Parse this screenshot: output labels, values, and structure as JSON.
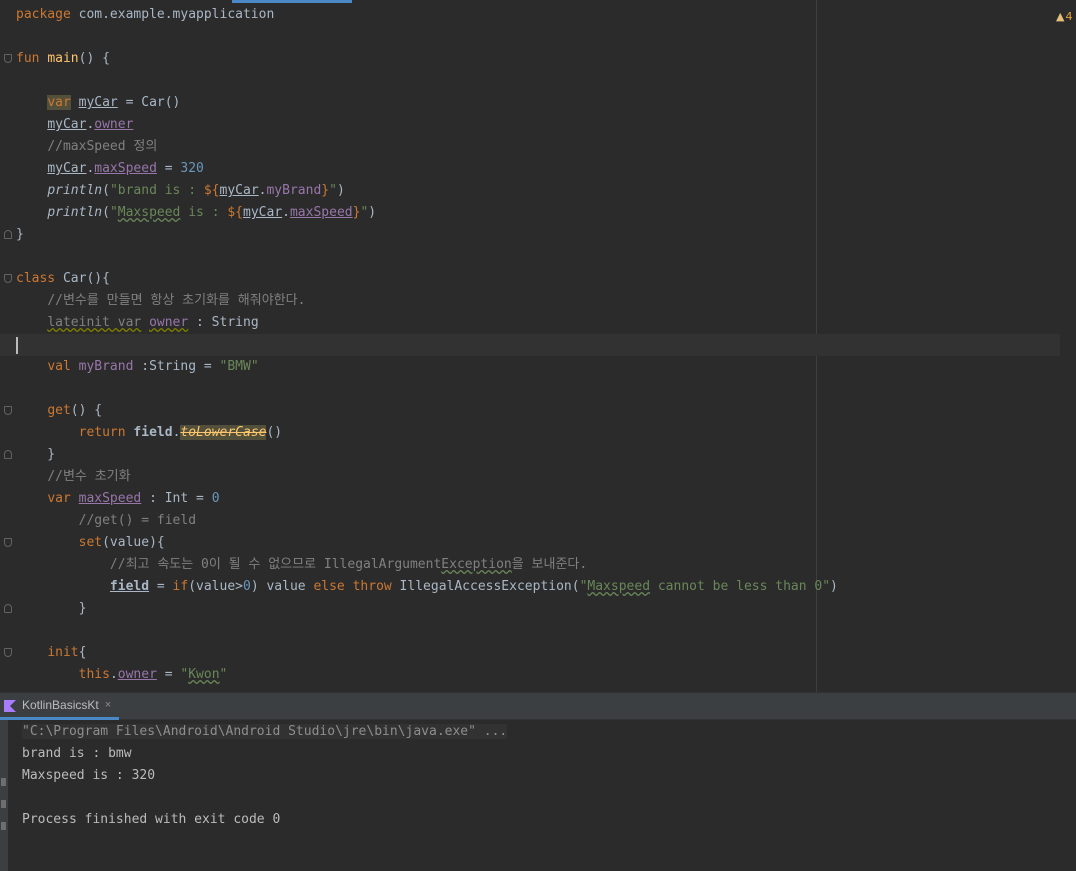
{
  "editor": {
    "warning_count": "4",
    "lines": [
      [
        "package com.example.myapplication"
      ],
      [
        ""
      ],
      [
        "fun main() {"
      ],
      [
        ""
      ],
      [
        "    var myCar = Car()"
      ],
      [
        "    myCar.owner"
      ],
      [
        "    //maxSpeed 정의"
      ],
      [
        "    myCar.maxSpeed = 320"
      ],
      [
        "    println(\"brand is : ${myCar.myBrand}\")"
      ],
      [
        "    println(\"Maxspeed is : ${myCar.maxSpeed}\")"
      ],
      [
        "}"
      ],
      [
        ""
      ],
      [
        "class Car(){"
      ],
      [
        "    //변수를 만들면 항상 초기화를 해줘야한다."
      ],
      [
        "    lateinit var owner : String"
      ],
      [
        ""
      ],
      [
        "    val myBrand :String = \"BMW\""
      ],
      [
        ""
      ],
      [
        "    get() {"
      ],
      [
        "        return field.toLowerCase()"
      ],
      [
        "    }"
      ],
      [
        "    //변수 초기화"
      ],
      [
        "    var maxSpeed : Int = 0"
      ],
      [
        "        //get() = field"
      ],
      [
        "        set(value){"
      ],
      [
        "            //최고 속도는 0이 될 수 없으므로 IllegalArgumentException을 보내준다."
      ],
      [
        "            field = if(value>0) value else throw IllegalAccessException(\"Maxspeed cannot be less than 0\")"
      ],
      [
        "        }"
      ],
      [
        ""
      ],
      [
        "    init{"
      ],
      [
        "        this.owner = \"Kwon\""
      ]
    ]
  },
  "run_panel": {
    "tab_label": "KotlinBasicsKt",
    "tab_close": "×",
    "console": [
      "\"C:\\Program Files\\Android\\Android Studio\\jre\\bin\\java.exe\" ...",
      "brand is : bmw",
      "Maxspeed is : 320",
      "",
      "Process finished with exit code 0"
    ]
  },
  "colors": {
    "background": "#2b2b2b",
    "keyword": "#cc7832",
    "string": "#6a8759",
    "number": "#6897bb",
    "comment": "#808080",
    "property": "#9876aa",
    "function": "#ffc66d",
    "text": "#a9b7c6"
  }
}
